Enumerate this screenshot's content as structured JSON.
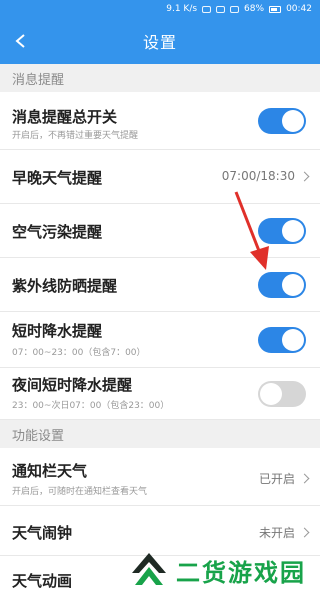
{
  "statusbar": {
    "speed": "9.1 K/s",
    "battery": "68%",
    "time": "00:42"
  },
  "header": {
    "title": "设置"
  },
  "sections": {
    "msg": "消息提醒",
    "func": "功能设置"
  },
  "rows": {
    "master": {
      "label": "消息提醒总开关",
      "desc": "开启后，不再错过重要天气提醒",
      "toggle": true
    },
    "morning": {
      "label": "早晚天气提醒",
      "value": "07:00/18:30"
    },
    "air": {
      "label": "空气污染提醒",
      "toggle": true
    },
    "uv": {
      "label": "紫外线防晒提醒",
      "toggle": true
    },
    "rain": {
      "label": "短时降水提醒",
      "desc": "07：00~23：00（包含7：00）",
      "toggle": true
    },
    "night_rain": {
      "label": "夜间短时降水提醒",
      "desc": "23：00~次日07：00（包含23：00）",
      "toggle": false
    },
    "notify_bar": {
      "label": "通知栏天气",
      "desc": "开启后，可随时在通知栏查看天气",
      "value": "已开启"
    },
    "alarm": {
      "label": "天气闹钟",
      "value": "未开启"
    },
    "anim": {
      "label": "天气动画"
    }
  },
  "watermark": {
    "text": "二货游戏园"
  },
  "colors": {
    "accent": "#3494ec",
    "toggle_on": "#2c86e6",
    "arrow": "#e0302a",
    "watermark": "#18a34a"
  }
}
